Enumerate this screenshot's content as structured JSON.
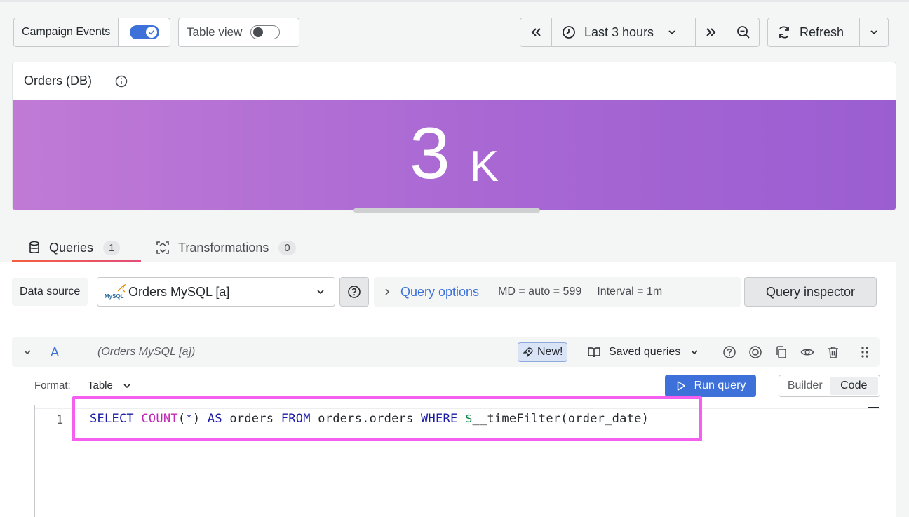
{
  "toolbar": {
    "campaign_events": "Campaign Events",
    "campaign_events_on": true,
    "table_view": "Table view",
    "table_view_on": false,
    "time_range": "Last 3 hours",
    "refresh": "Refresh"
  },
  "panel": {
    "title": "Orders (DB)",
    "stat_value": "3",
    "stat_unit": "K"
  },
  "tabs": [
    {
      "label": "Queries",
      "count": "1",
      "active": true
    },
    {
      "label": "Transformations",
      "count": "0",
      "active": false
    }
  ],
  "datasource": {
    "label": "Data source",
    "selected": "Orders MySQL [a]",
    "logo_text": "MySQL"
  },
  "query_options": {
    "label": "Query options",
    "md": "MD = auto = 599",
    "interval": "Interval = 1m"
  },
  "query_inspector": "Query inspector",
  "query": {
    "ref_id": "A",
    "datasource": "(Orders MySQL [a])",
    "new_badge": "New!",
    "saved_queries": "Saved queries",
    "format_label": "Format:",
    "format_value": "Table",
    "run_query": "Run query",
    "modes": [
      "Builder",
      "Code"
    ],
    "selected_mode": "Code",
    "line_number": "1",
    "sql_tokens": {
      "select": "SELECT",
      "count": "COUNT",
      "open": "(",
      "star": "*",
      "close": ")",
      "as": "AS",
      "alias": "orders",
      "from": "FROM",
      "table": "orders.orders",
      "where": "WHERE",
      "dollar": "$",
      "macro": "__timeFilter(order_date)"
    }
  },
  "colors": {
    "accent": "#3d71d9",
    "stat_gradient_start": "#c07ad6",
    "stat_gradient_end": "#9b5ed1",
    "highlight": "#f55ff0"
  }
}
